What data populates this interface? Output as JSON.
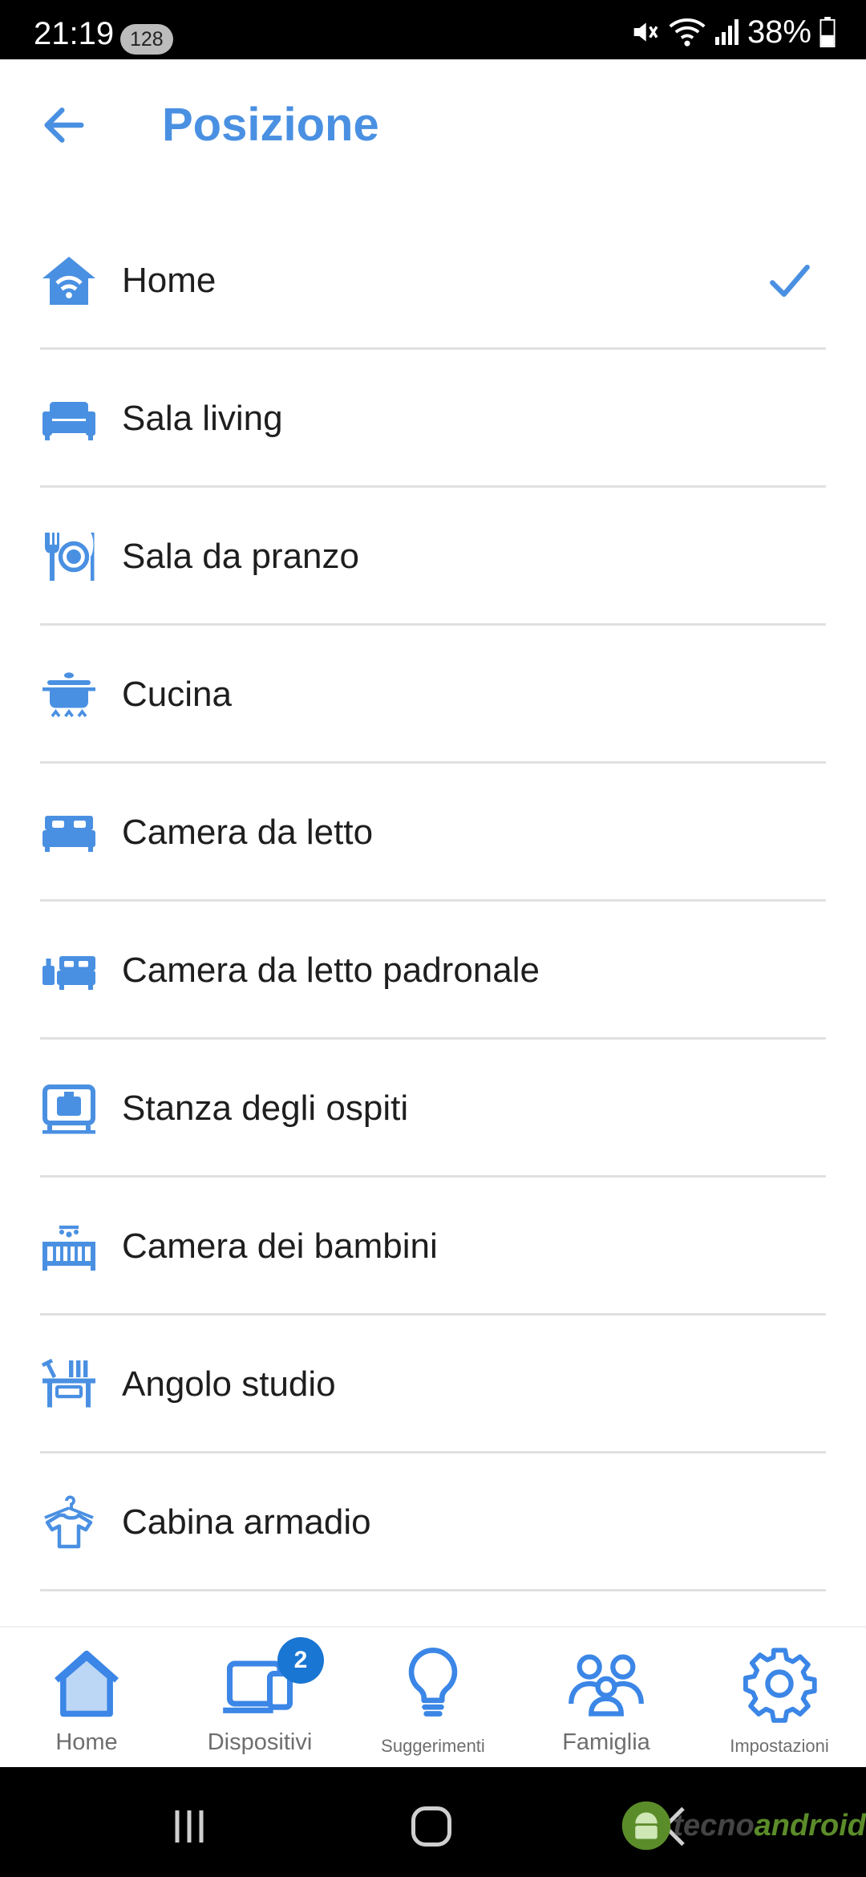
{
  "status_bar": {
    "time": "21:19",
    "badge": "128",
    "battery": "38%"
  },
  "header": {
    "title": "Posizione",
    "back_icon": "arrow-left-icon"
  },
  "accent_color": "#4a90e2",
  "rooms": [
    {
      "label": "Home",
      "icon": "home-wifi-icon",
      "selected": true
    },
    {
      "label": "Sala living",
      "icon": "sofa-icon",
      "selected": false
    },
    {
      "label": "Sala da pranzo",
      "icon": "dining-icon",
      "selected": false
    },
    {
      "label": "Cucina",
      "icon": "cooking-pot-icon",
      "selected": false
    },
    {
      "label": "Camera da letto",
      "icon": "bed-icon",
      "selected": false
    },
    {
      "label": "Camera da letto padronale",
      "icon": "master-bed-icon",
      "selected": false
    },
    {
      "label": "Stanza degli ospiti",
      "icon": "suitcase-icon",
      "selected": false
    },
    {
      "label": "Camera dei bambini",
      "icon": "crib-icon",
      "selected": false
    },
    {
      "label": "Angolo studio",
      "icon": "desk-icon",
      "selected": false
    },
    {
      "label": "Cabina armadio",
      "icon": "clothes-hanger-icon",
      "selected": false
    }
  ],
  "bottom_nav": [
    {
      "label": "Home",
      "icon": "home-icon"
    },
    {
      "label": "Dispositivi",
      "icon": "devices-icon",
      "badge": "2"
    },
    {
      "label": "Suggerimenti",
      "icon": "lightbulb-icon"
    },
    {
      "label": "Famiglia",
      "icon": "family-icon"
    },
    {
      "label": "Impostazioni",
      "icon": "gear-icon"
    }
  ],
  "watermark": {
    "part1": "tecno",
    "part2": "android"
  }
}
